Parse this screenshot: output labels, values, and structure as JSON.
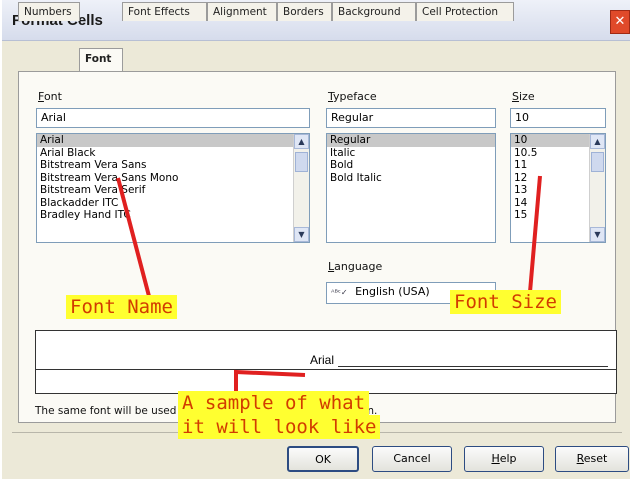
{
  "window": {
    "title": "Format Cells",
    "close_glyph": "✕"
  },
  "tabs": [
    "Numbers",
    "Font",
    "Font Effects",
    "Alignment",
    "Borders",
    "Background",
    "Cell Protection"
  ],
  "active_tab": "Font",
  "font": {
    "label_first": "F",
    "label_rest": "ont",
    "value": "Arial",
    "items": [
      "Arial",
      "Arial Black",
      "Bitstream Vera Sans",
      "Bitstream Vera Sans Mono",
      "Bitstream Vera Serif",
      "Blackadder ITC",
      "Bradley Hand ITC"
    ],
    "selected": "Arial"
  },
  "typeface": {
    "label_first": "T",
    "label_rest": "ypeface",
    "value": "Regular",
    "items": [
      "Regular",
      "Italic",
      "Bold",
      "Bold Italic"
    ],
    "selected": "Regular"
  },
  "size": {
    "label_first": "S",
    "label_rest": "ize",
    "value": "10",
    "items": [
      "10",
      "10.5",
      "11",
      "12",
      "13",
      "14",
      "15"
    ],
    "selected": "10"
  },
  "language": {
    "label_first": "L",
    "label_rest": "anguage",
    "value": "English (USA)",
    "spell_icon": "ᴬᴮᶜ✓"
  },
  "preview": {
    "sample_text": "Arial"
  },
  "note": "The same font will be used on both your printer and your screen.",
  "buttons": {
    "ok": "OK",
    "cancel": "Cancel",
    "help_first": "H",
    "help_rest": "elp",
    "reset_first": "R",
    "reset_rest": "eset"
  },
  "annotations": {
    "font_name": "Font Name",
    "font_size": "Font Size",
    "sample_line1": "A sample of what",
    "sample_line2": "it will look like",
    "color": "#d23c00",
    "highlight": "#ffff30"
  }
}
